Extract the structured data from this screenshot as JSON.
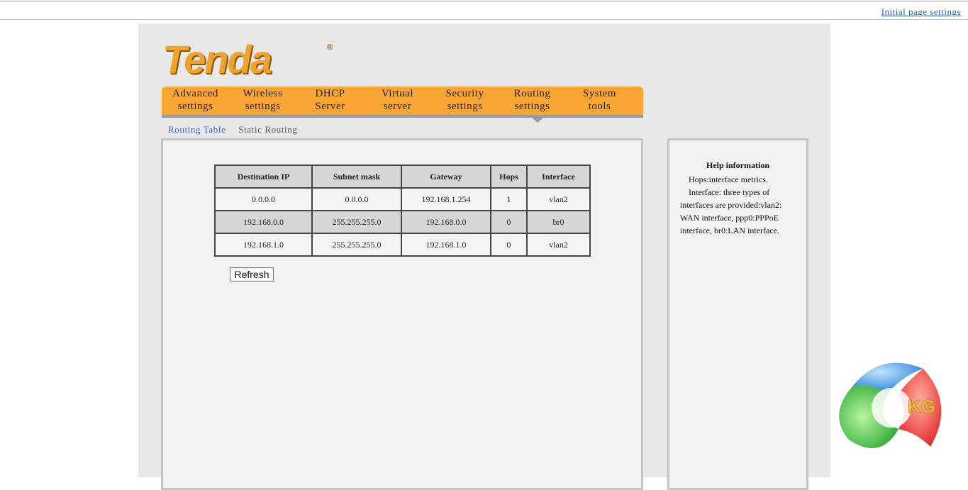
{
  "header": {
    "initial_link": "Initial page settings"
  },
  "logo": {
    "text": "Tenda",
    "reg": "®"
  },
  "nav": {
    "items": [
      {
        "line1": "Advanced",
        "line2": "settings"
      },
      {
        "line1": "Wireless",
        "line2": "settings"
      },
      {
        "line1": "DHCP",
        "line2": "Server"
      },
      {
        "line1": "Virtual",
        "line2": "server"
      },
      {
        "line1": "Security",
        "line2": "settings"
      },
      {
        "line1": "Routing",
        "line2": "settings"
      },
      {
        "line1": "System",
        "line2": "tools"
      }
    ],
    "active": "Routing settings"
  },
  "subtabs": {
    "routing_table": "Routing Table",
    "static_routing": "Static Routing"
  },
  "table": {
    "headers": [
      "Destination IP",
      "Subnet mask",
      "Gateway",
      "Hops",
      "Interface"
    ],
    "rows": [
      [
        "0.0.0.0",
        "0.0.0.0",
        "192.168.1.254",
        "1",
        "vlan2"
      ],
      [
        "192.168.0.0",
        "255.255.255.0",
        "192.168.0.0",
        "0",
        "br0"
      ],
      [
        "192.168.1.0",
        "255.255.255.0",
        "192.168.1.0",
        "0",
        "vlan2"
      ]
    ]
  },
  "refresh_label": "Refresh",
  "help": {
    "title": "Help information",
    "line1": "Hops:interface metrics.",
    "line2": "Interface: three types of interfaces are provided:vlan2: WAN interface, ppp0:PPPoE interface, br0:LAN interface."
  },
  "watermark": {
    "text": "KG"
  },
  "colors": {
    "nav_orange": "#f9a635",
    "link_blue": "#3a63c8",
    "logo_orange": "#f0a22e"
  }
}
